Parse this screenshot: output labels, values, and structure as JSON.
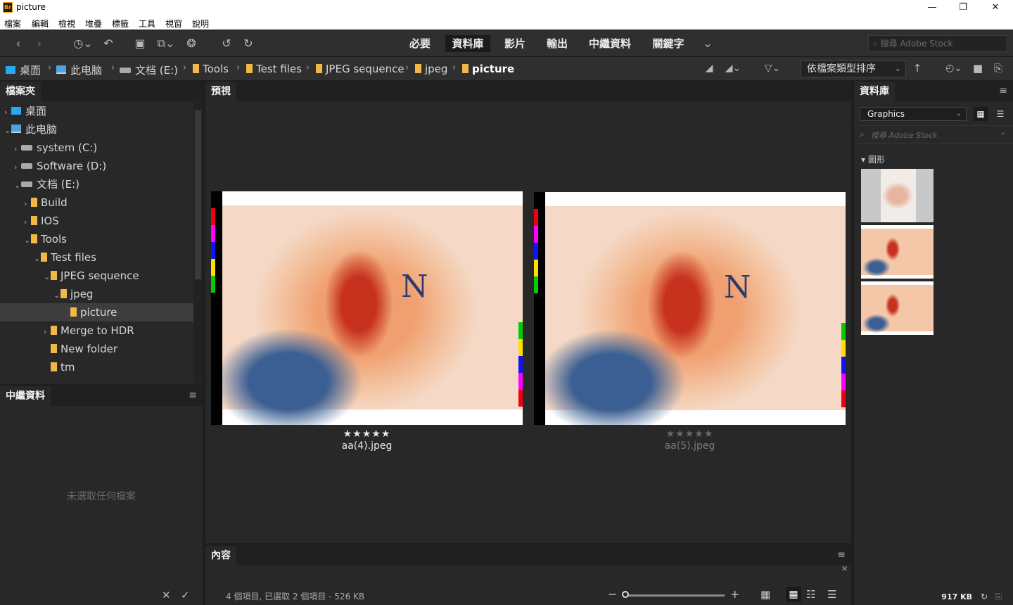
{
  "window": {
    "title": "picture",
    "app_icon": "Br",
    "minimize": "—",
    "maximize": "❐",
    "close": "✕"
  },
  "menu": [
    "檔案",
    "編輯",
    "檢視",
    "堆疊",
    "標籤",
    "工具",
    "視窗",
    "說明"
  ],
  "toolbar": {
    "workspaces": [
      "必要",
      "資料庫",
      "影片",
      "輸出",
      "中繼資料",
      "關鍵字"
    ],
    "active_workspace": "資料庫",
    "search_placeholder": "搜尋 Adobe Stock"
  },
  "breadcrumb": [
    "桌面",
    "此电脑",
    "文档 (E:)",
    "Tools",
    "Test files",
    "JPEG sequence",
    "jpeg",
    "picture"
  ],
  "sort": {
    "label": "依檔案類型排序"
  },
  "folders_panel": {
    "title": "檔案夾",
    "items": [
      {
        "label": "桌面",
        "level": 0,
        "arrow": "›",
        "icon": "desktop-folder-icon"
      },
      {
        "label": "此电脑",
        "level": 0,
        "arrow": "⌄",
        "icon": "computer-icon"
      },
      {
        "label": "system (C:)",
        "level": 1,
        "arrow": "›",
        "icon": "drive-icon"
      },
      {
        "label": "Software (D:)",
        "level": 1,
        "arrow": "›",
        "icon": "drive-icon"
      },
      {
        "label": "文档 (E:)",
        "level": 1,
        "arrow": "⌄",
        "icon": "drive-icon"
      },
      {
        "label": "Build",
        "level": 2,
        "arrow": "›",
        "icon": "folder-icon"
      },
      {
        "label": "IOS",
        "level": 2,
        "arrow": "›",
        "icon": "folder-icon"
      },
      {
        "label": "Tools",
        "level": 2,
        "arrow": "⌄",
        "icon": "folder-icon"
      },
      {
        "label": "Test files",
        "level": 3,
        "arrow": "⌄",
        "icon": "folder-icon"
      },
      {
        "label": "JPEG sequence",
        "level": 4,
        "arrow": "⌄",
        "icon": "folder-icon"
      },
      {
        "label": "jpeg",
        "level": 5,
        "arrow": "⌄",
        "icon": "folder-icon"
      },
      {
        "label": "picture",
        "level": 6,
        "arrow": "",
        "icon": "folder-icon",
        "selected": true
      },
      {
        "label": "Merge to HDR",
        "level": 4,
        "arrow": "›",
        "icon": "folder-icon"
      },
      {
        "label": "New folder",
        "level": 4,
        "arrow": "",
        "icon": "folder-icon"
      },
      {
        "label": "tm",
        "level": 4,
        "arrow": "",
        "icon": "folder-icon"
      }
    ]
  },
  "metadata_panel": {
    "title": "中繼資料",
    "empty_text": "未選取任何檔案"
  },
  "preview_panel": {
    "title": "預視",
    "items": [
      {
        "filename": "aa(4).jpeg",
        "stars": "★★★★★",
        "rating": 5
      },
      {
        "filename": "aa(5).jpeg",
        "stars": "★★★★★",
        "rating": 0
      }
    ]
  },
  "content_panel": {
    "title": "內容",
    "status": "4 個項目, 已選取 2 個項目 - 526 KB"
  },
  "library_panel": {
    "title": "資料庫",
    "library_name": "Graphics",
    "search_placeholder": "搜尋 Adobe Stock",
    "section": "圖形",
    "size": "917 KB"
  },
  "colors": {
    "accent": "#ef9c0e",
    "folder": "#f0b847",
    "panel": "#282828",
    "background": "#1e1e1e"
  }
}
